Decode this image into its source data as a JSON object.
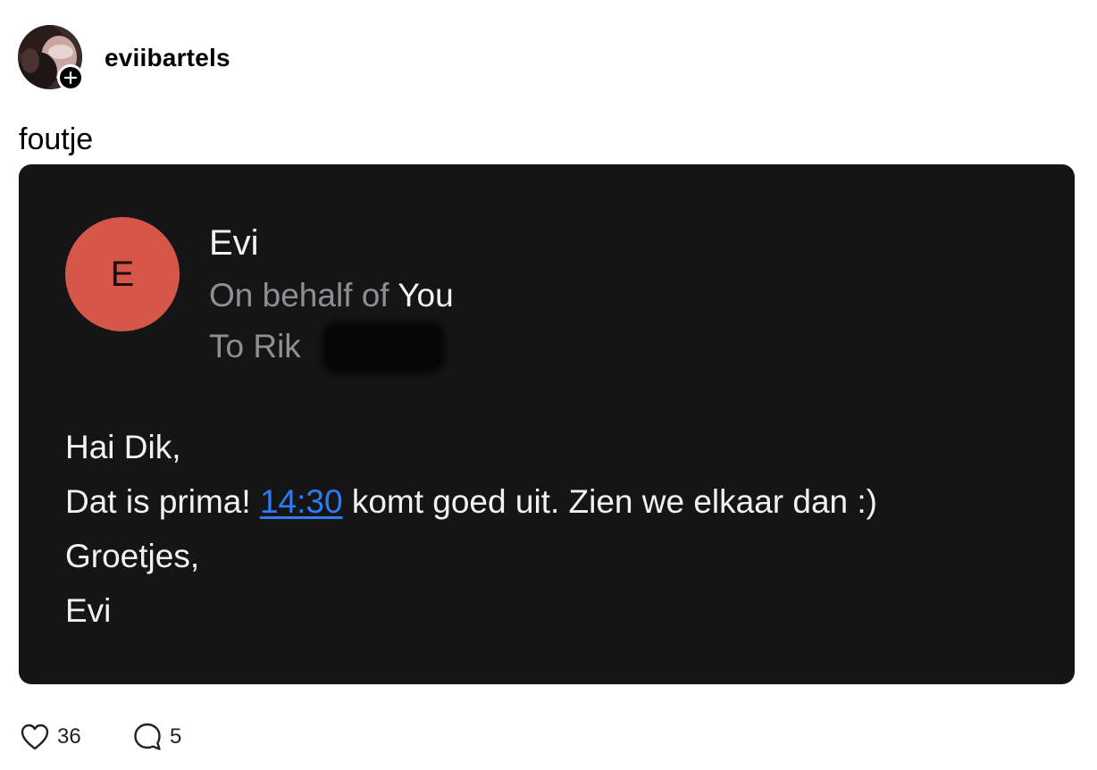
{
  "post": {
    "username": "eviibartels",
    "text": "foutje"
  },
  "email": {
    "sender_initial": "E",
    "sender_name": "Evi",
    "behalf_prefix": "On behalf of",
    "behalf_name": "You",
    "to_text": "To Rik",
    "body": {
      "greeting": "Hai Dik,",
      "line2_before": "Dat is prima!",
      "line2_link": "14:30",
      "line2_after": "komt goed uit. Zien we elkaar dan :)",
      "closing": "Groetjes,",
      "signature": "Evi"
    }
  },
  "actions": {
    "likes": "36",
    "comments": "5"
  },
  "icons": {
    "follow": "plus-icon",
    "like": "heart-icon",
    "comment": "comment-bubble-icon"
  },
  "colors": {
    "card_background": "#151516",
    "avatar_circle": "#d6574a",
    "link": "#2f7bf5",
    "muted_text": "#8e8e93"
  }
}
